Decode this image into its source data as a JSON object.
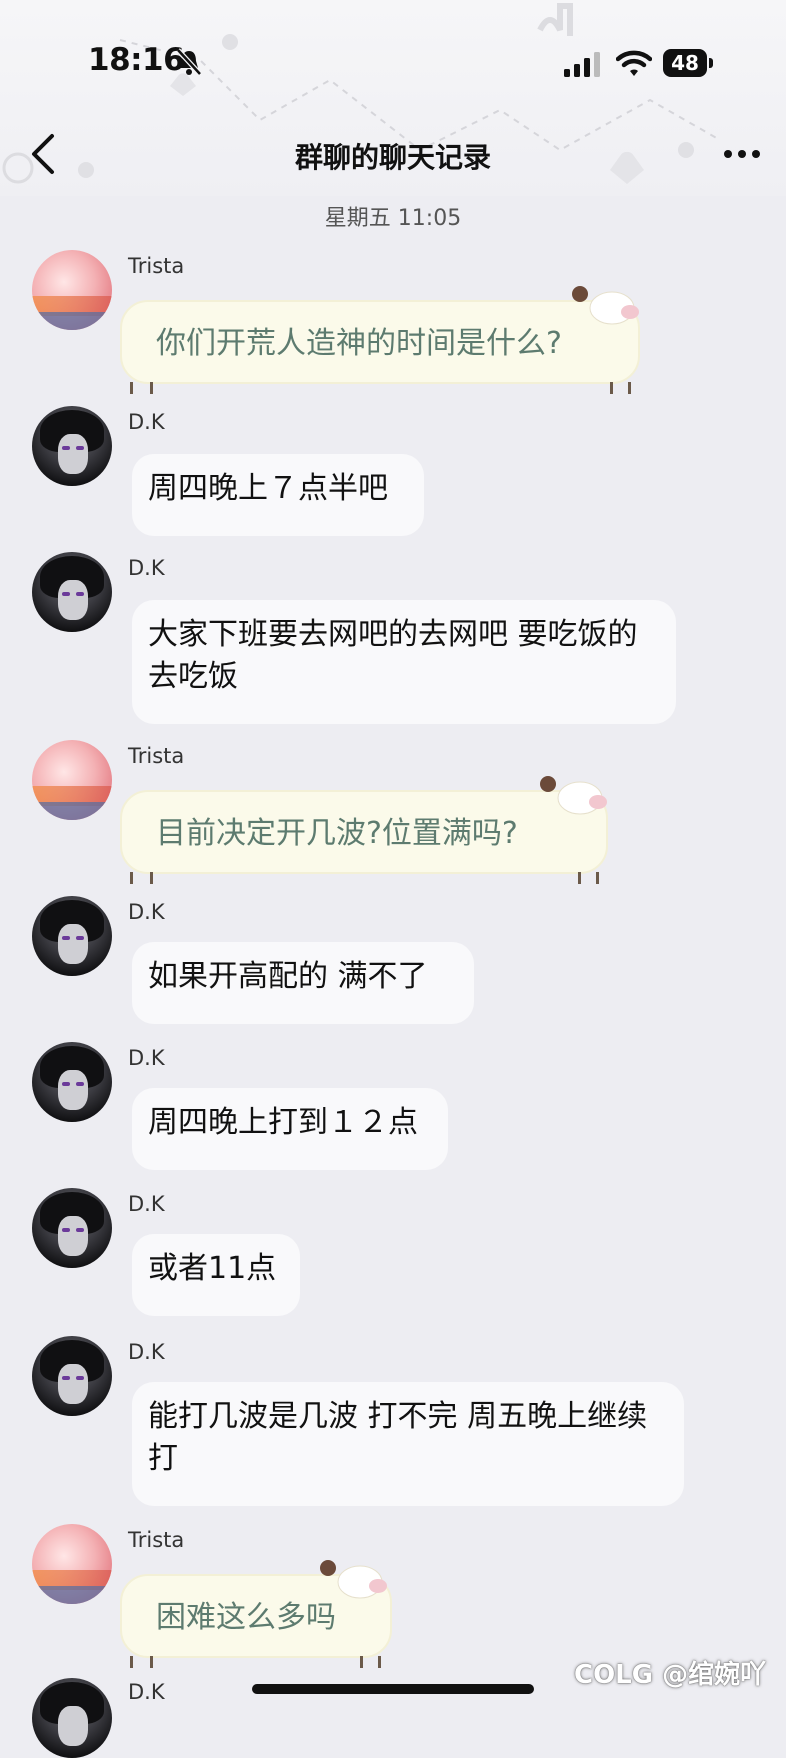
{
  "status_bar": {
    "time": "18:16",
    "battery": "48"
  },
  "header": {
    "title": "群聊的聊天记录"
  },
  "timestamp": "星期五 11:05",
  "messages": [
    {
      "sender": "Trista",
      "text": "你们开荒人造神的时间是什么?"
    },
    {
      "sender": "D.K",
      "text": "周四晚上７点半吧"
    },
    {
      "sender": "D.K",
      "text": "大家下班要去网吧的去网吧 要吃饭的去吃饭"
    },
    {
      "sender": "Trista",
      "text": "目前决定开几波?位置满吗?"
    },
    {
      "sender": "D.K",
      "text": "如果开高配的 满不了"
    },
    {
      "sender": "D.K",
      "text": "周四晚上打到１２点"
    },
    {
      "sender": "D.K",
      "text": "或者11点"
    },
    {
      "sender": "D.K",
      "text": "能打几波是几波 打不完 周五晚上继续打"
    },
    {
      "sender": "Trista",
      "text": "困难这么多吗"
    },
    {
      "sender": "D.K",
      "text": ""
    }
  ],
  "watermark": "COLG @绾婉吖",
  "colors": {
    "background": "#ededf2",
    "bubble": "#f9f9fb",
    "sheep_bubble": "#fbfaea",
    "sheep_text": "#5d7b6f"
  }
}
